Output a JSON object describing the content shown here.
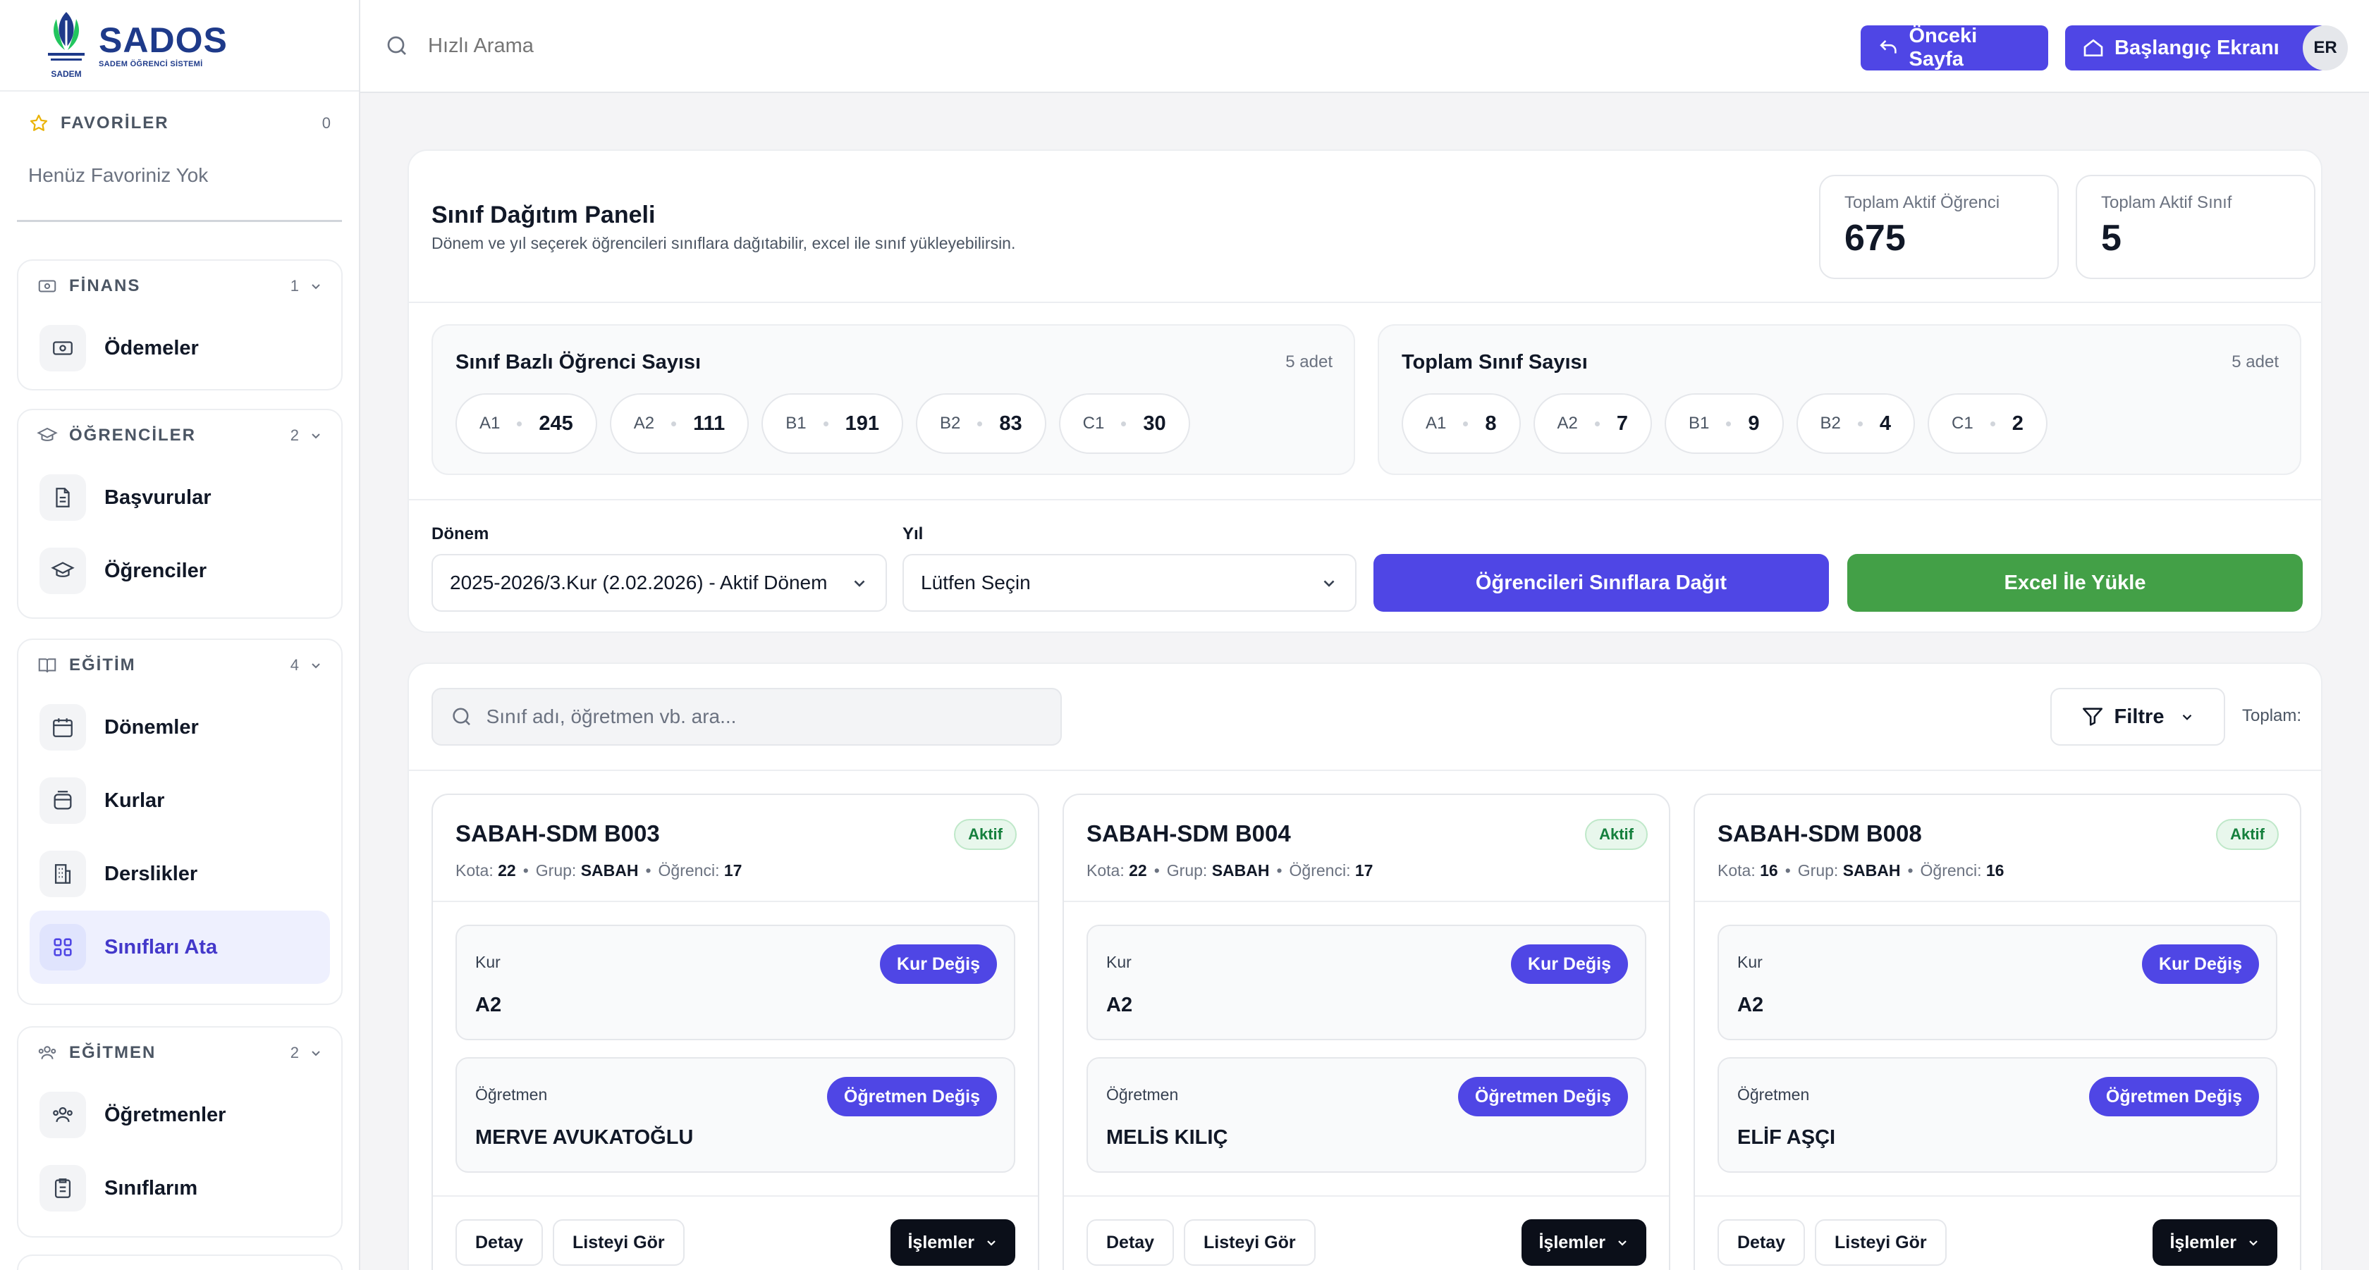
{
  "app": {
    "brand": "SADOS",
    "brand_sub": "SADEM ÖĞRENCİ SİSTEMİ",
    "logo_caption": "SADEM"
  },
  "favorites": {
    "title": "FAVORİLER",
    "count": "0",
    "empty_text": "Henüz Favoriniz Yok"
  },
  "sidebar": {
    "groups": [
      {
        "title": "FİNANS",
        "count": "1",
        "icon": "money-icon",
        "items": [
          {
            "label": "Ödemeler",
            "icon": "cash-icon"
          }
        ]
      },
      {
        "title": "ÖĞRENCİLER",
        "count": "2",
        "icon": "graduation-cap-icon",
        "items": [
          {
            "label": "Başvurular",
            "icon": "document-icon"
          },
          {
            "label": "Öğrenciler",
            "icon": "graduation-cap-icon"
          }
        ]
      },
      {
        "title": "EĞİTİM",
        "count": "4",
        "icon": "book-icon",
        "items": [
          {
            "label": "Dönemler",
            "icon": "calendar-icon"
          },
          {
            "label": "Kurlar",
            "icon": "layers-icon"
          },
          {
            "label": "Derslikler",
            "icon": "building-icon"
          },
          {
            "label": "Sınıfları Ata",
            "icon": "grid-icon"
          }
        ]
      },
      {
        "title": "EĞİTMEN",
        "count": "2",
        "icon": "users-icon",
        "items": [
          {
            "label": "Öğretmenler",
            "icon": "users-icon"
          },
          {
            "label": "Sınıflarım",
            "icon": "clipboard-icon"
          }
        ]
      }
    ]
  },
  "topbar": {
    "search_placeholder": "Hızlı Arama",
    "prev_page": "Önceki Sayfa",
    "home": "Başlangıç Ekranı",
    "avatar": "ER"
  },
  "panel": {
    "title": "Sınıf Dağıtım Paneli",
    "subtitle": "Dönem ve yıl seçerek öğrencileri sınıflara dağıtabilir, excel ile sınıf yükleyebilirsin.",
    "stats": [
      {
        "label": "Toplam Aktif Öğrenci",
        "value": "675"
      },
      {
        "label": "Toplam Aktif Sınıf",
        "value": "5"
      }
    ],
    "student_dist": {
      "title": "Sınıf Bazlı Öğrenci Sayısı",
      "count": "5 adet",
      "chips": [
        {
          "level": "A1",
          "value": "245"
        },
        {
          "level": "A2",
          "value": "111"
        },
        {
          "level": "B1",
          "value": "191"
        },
        {
          "level": "B2",
          "value": "83"
        },
        {
          "level": "C1",
          "value": "30"
        }
      ]
    },
    "class_dist": {
      "title": "Toplam Sınıf Sayısı",
      "count": "5 adet",
      "chips": [
        {
          "level": "A1",
          "value": "8"
        },
        {
          "level": "A2",
          "value": "7"
        },
        {
          "level": "B1",
          "value": "9"
        },
        {
          "level": "B2",
          "value": "4"
        },
        {
          "level": "C1",
          "value": "2"
        }
      ]
    },
    "term_label": "Dönem",
    "term_value": "2025-2026/3.Kur (2.02.2026) - Aktif Dönem",
    "year_label": "Yıl",
    "year_value": "Lütfen Seçin",
    "distribute_button": "Öğrencileri Sınıflara Dağıt",
    "excel_button": "Excel İle Yükle",
    "colors": {
      "primary": "#4f46e5",
      "success": "#43a047",
      "dark": "#0b0f19"
    }
  },
  "list": {
    "search_placeholder": "Sınıf adı, öğretmen vb. ara...",
    "filter_label": "Filtre",
    "total_label": "Toplam:",
    "card_labels": {
      "quota": "Kota:",
      "group": "Grup:",
      "students": "Öğrenci:",
      "level": "Kur",
      "level_change": "Kur Değiş",
      "teacher": "Öğretmen",
      "teacher_change": "Öğretmen Değiş",
      "detail": "Detay",
      "view_list": "Listeyi Gör",
      "actions": "İşlemler"
    },
    "cards": [
      {
        "name": "SABAH-SDM B003",
        "status": "Aktif",
        "quota": "22",
        "group": "SABAH",
        "students": "17",
        "level": "A2",
        "teacher": "MERVE AVUKATOĞLU"
      },
      {
        "name": "SABAH-SDM B004",
        "status": "Aktif",
        "quota": "22",
        "group": "SABAH",
        "students": "17",
        "level": "A2",
        "teacher": "MELİS KILIÇ"
      },
      {
        "name": "SABAH-SDM B008",
        "status": "Aktif",
        "quota": "16",
        "group": "SABAH",
        "students": "16",
        "level": "A2",
        "teacher": "ELİF AŞÇI"
      }
    ]
  }
}
